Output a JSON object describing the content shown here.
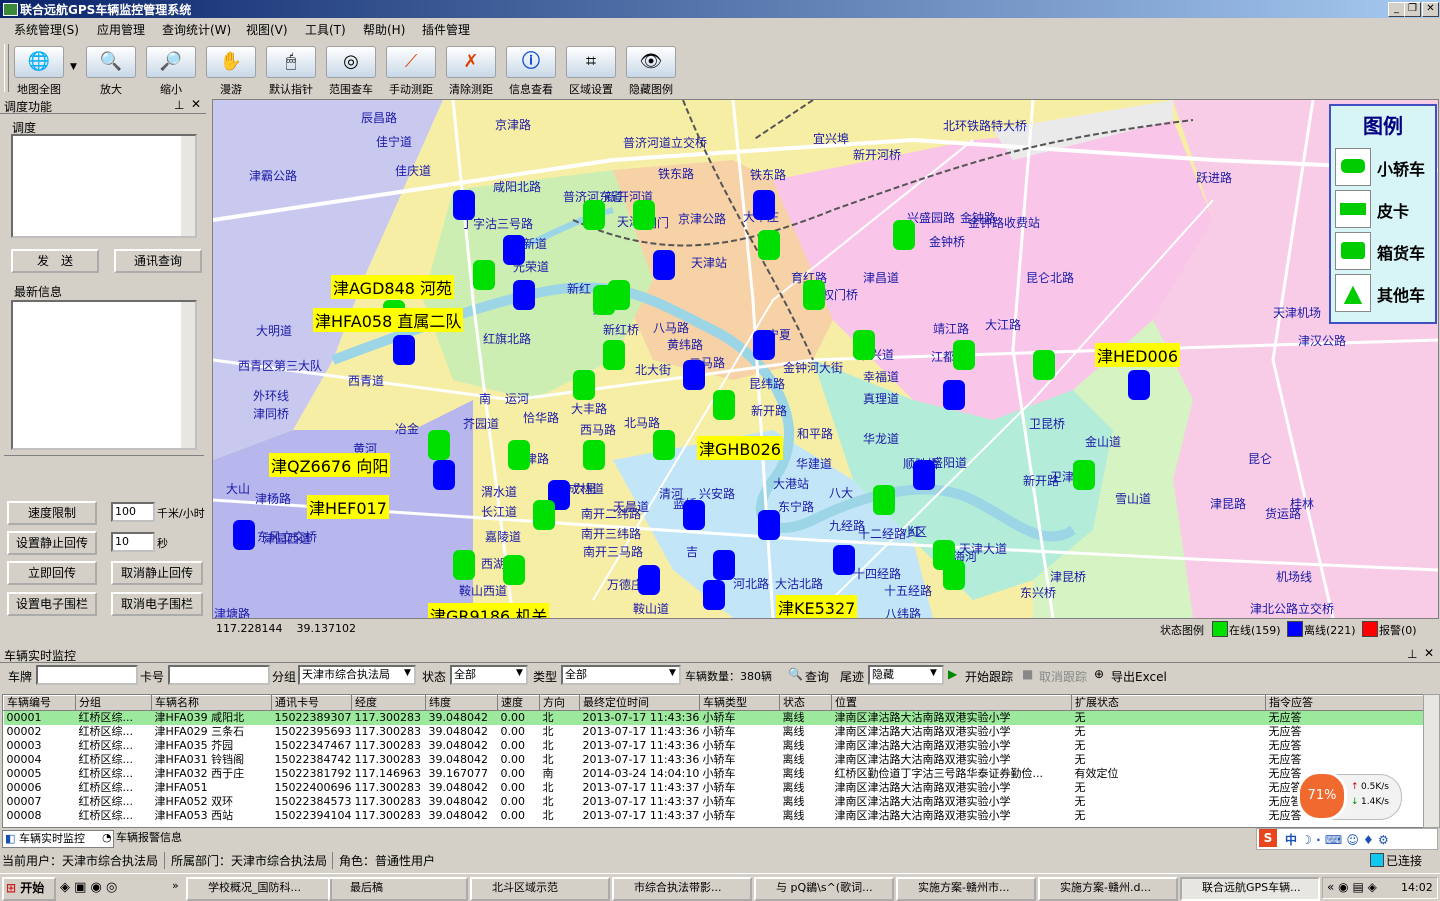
{
  "window": {
    "title": "联合远航GPS车辆监控管理系统"
  },
  "menu": [
    "系统管理(S)",
    "应用管理",
    "查询统计(W)",
    "视图(V)",
    "工具(T)",
    "帮助(H)",
    "插件管理"
  ],
  "toolbar": [
    {
      "label": "地图全图",
      "icon": "globe-icon"
    },
    {
      "label": "放大",
      "icon": "zoom-in-icon"
    },
    {
      "label": "缩小",
      "icon": "zoom-out-icon"
    },
    {
      "label": "漫游",
      "icon": "hand-icon"
    },
    {
      "label": "默认指针",
      "icon": "mouse-icon"
    },
    {
      "label": "范围查车",
      "icon": "radar-icon"
    },
    {
      "label": "手动测距",
      "icon": "ruler-icon"
    },
    {
      "label": "清除测距",
      "icon": "clear-ruler-icon"
    },
    {
      "label": "信息查看",
      "icon": "info-icon"
    },
    {
      "label": "区域设置",
      "icon": "area-icon"
    },
    {
      "label": "隐藏图例",
      "icon": "eye-icon"
    }
  ],
  "dispatch": {
    "title": "调度功能",
    "group_label": "调度",
    "send_button": "发　送",
    "comm_query_button": "通讯查询",
    "latest_info_label": "最新信息",
    "speed_limit_button": "速度限制",
    "speed_value": "100",
    "speed_unit": "千米/小时",
    "static_return_button": "设置静止回传",
    "static_value": "10",
    "static_unit": "秒",
    "instant_return_button": "立即回传",
    "cancel_static_button": "取消静止回传",
    "set_fence_button": "设置电子围栏",
    "cancel_fence_button": "取消电子围栏"
  },
  "map": {
    "labels": [
      "辰昌路",
      "佳宁道",
      "京津路",
      "普济河道立交桥",
      "宜兴埠",
      "北环铁路特大桥",
      "新开河桥",
      "佳庆道",
      "津霸公路",
      "咸阳北路",
      "丁字沽三号路",
      "普济河东道",
      "铁东路",
      "铁东路",
      "天津大",
      "阀门",
      "四新道",
      "光荣道",
      "京津公路",
      "大毕庄",
      "天津站",
      "新开河道",
      "金钟路",
      "兴盛园路",
      "金钟路收费站",
      "金钟桥",
      "跃进路",
      "昆仑北路",
      "新红",
      "红",
      "新红桥",
      "红旗北路",
      "八马路",
      "黄纬路",
      "二马路",
      "育红路",
      "民权门桥",
      "津昌道",
      "宁夏",
      "靖江路",
      "大江路",
      "天津机场",
      "津汉公路",
      "西青区第三大队",
      "大明道",
      "西青道",
      "外环线",
      "津同桥",
      "南",
      "运河",
      "恰华路",
      "大丰路",
      "北马路",
      "北大街",
      "西马路",
      "昆纬路",
      "新开路",
      "金钟河大街",
      "泰兴道",
      "幸福道",
      "江都路",
      "真理道",
      "卫昆桥",
      "金山道",
      "冶金",
      "芥园道",
      "黄河",
      "天晨道",
      "卫津路",
      "和平路",
      "华龙道",
      "顺驰桥",
      "新开路",
      "盛阳道",
      "昆仑",
      "成林道",
      "渭水道",
      "长江道",
      "六里",
      "南开二纬路",
      "南开三纬路",
      "清河",
      "兴安路",
      "华建道",
      "大港站",
      "东宁路",
      "小区",
      "津杨路",
      "东风立交桥",
      "天津大道",
      "十二经路",
      "九经路",
      "十四经路",
      "十五经路",
      "八纬路",
      "东兴桥",
      "津昆桥",
      "机场线",
      "津北公路立交桥",
      "津塘路",
      "嘉陵道",
      "西湖",
      "南开三马路",
      "万德庄",
      "鞍山西道",
      "鞍山道",
      "津园西道",
      "大沽北路",
      "河北路",
      "吉",
      "红",
      "海河",
      "蓝桥",
      "卫津",
      "津昆路",
      "桂林",
      "货运路",
      "雪山道",
      "八大",
      "大山"
    ],
    "plates": [
      "津AGD848 河苑",
      "津HFA058 直属二队",
      "津QZ6676 向阳",
      "津HEF017",
      "津GR9186 机关",
      "津GHB026",
      "津KE5327",
      "津HED006"
    ],
    "legend": {
      "title": "图例",
      "items": [
        "小轿车",
        "皮卡",
        "箱货车",
        "其他车"
      ]
    },
    "coords": "117.228144    39.137102",
    "status_legend_label": "状态图例",
    "online": "在线(159)",
    "offline": "离线(221)",
    "alarm": "报警(0)",
    "colors": {
      "online": "#00e000",
      "offline": "#0000ff",
      "alarm": "#ff0000",
      "water": "#9bd5e6",
      "residential": "#f7eea6"
    }
  },
  "monitor": {
    "title": "车辆实时监控",
    "plate_label": "车牌",
    "card_label": "卡号",
    "group_label": "分组",
    "group_value": "天津市综合执法局",
    "status_label": "状态",
    "status_value": "全部",
    "type_label": "类型",
    "type_value": "全部",
    "vehicle_count": "车辆数量：380辆",
    "query_button": "查询",
    "trail_label": "尾迹",
    "trail_value": "隐藏",
    "start_track": "开始跟踪",
    "cancel_track": "取消跟踪",
    "export": "导出Excel",
    "columns": [
      "车辆编号",
      "分组",
      "车辆名称",
      "通讯卡号",
      "经度",
      "纬度",
      "速度",
      "方向",
      "最终定位时间",
      "车辆类型",
      "状态",
      "位置",
      "扩展状态",
      "指令应答"
    ],
    "rows": [
      [
        "00001",
        "红桥区综...",
        "津HFA039 咸阳北",
        "15022389307",
        "117.300283",
        "39.048042",
        "0.00",
        "北",
        "2013-07-17 11:43:36",
        "小轿车",
        "离线",
        "津南区津沽路大沽南路双港实验小学",
        "无",
        "无应答"
      ],
      [
        "00002",
        "红桥区综...",
        "津HFA029 三条石",
        "15022395693",
        "117.300283",
        "39.048042",
        "0.00",
        "北",
        "2013-07-17 11:43:36",
        "小轿车",
        "离线",
        "津南区津沽路大沽南路双港实验小学",
        "无",
        "无应答"
      ],
      [
        "00003",
        "红桥区综...",
        "津HFA035 芥园",
        "15022347467",
        "117.300283",
        "39.048042",
        "0.00",
        "北",
        "2013-07-17 11:43:36",
        "小轿车",
        "离线",
        "津南区津沽路大沽南路双港实验小学",
        "无",
        "无应答"
      ],
      [
        "00004",
        "红桥区综...",
        "津HFA031 铃铛阁",
        "15022384742",
        "117.300283",
        "39.048042",
        "0.00",
        "北",
        "2013-07-17 11:43:36",
        "小轿车",
        "离线",
        "津南区津沽路大沽南路双港实验小学",
        "无",
        "无应答"
      ],
      [
        "00005",
        "红桥区综...",
        "津HFA032 西于庄",
        "15022381792",
        "117.146963",
        "39.167077",
        "0.00",
        "南",
        "2014-03-24 14:04:10",
        "小轿车",
        "离线",
        "红桥区勤俭道丁字沽三号路华泰证券勤俭...",
        "有效定位",
        "无应答"
      ],
      [
        "00006",
        "红桥区综...",
        "津HFA051",
        "15022400696",
        "117.300283",
        "39.048042",
        "0.00",
        "北",
        "2013-07-17 11:43:37",
        "小轿车",
        "离线",
        "津南区津沽路大沽南路双港实验小学",
        "无",
        "无应答"
      ],
      [
        "00007",
        "红桥区综...",
        "津HFA052 双环",
        "15022384573",
        "117.300283",
        "39.048042",
        "0.00",
        "北",
        "2013-07-17 11:43:37",
        "小轿车",
        "离线",
        "津南区津沽路大沽南路双港实验小学",
        "无",
        "无应答"
      ],
      [
        "00008",
        "红桥区综...",
        "津HFA053 西站",
        "15022394104",
        "117.300283",
        "39.048042",
        "0.00",
        "北",
        "2013-07-17 11:43:37",
        "小轿车",
        "离线",
        "津南区津沽路大沽南路双港实验小学",
        "无",
        "无应答"
      ]
    ],
    "tabs": [
      "车辆实时监控",
      "车辆报警信息"
    ],
    "net": {
      "percent": "71%",
      "up": "0.5K/s",
      "down": "1.4K/s"
    }
  },
  "statusbar": {
    "user": "当前用户：天津市综合执法局",
    "dept": "所属部门：天津市综合执法局",
    "role": "角色：普通性用户",
    "connection": "已连接"
  },
  "taskbar": {
    "start": "开始",
    "tasks": [
      "学校概况_国防科...",
      "最后稿",
      "北斗区域示范",
      "市综合执法带影...",
      "与 pQ鶲\\s^(歌词...",
      "实施方案-赣州市...",
      "实施方案-赣州.d...",
      "联合远航GPS车辆..."
    ],
    "clock": "14:02"
  }
}
